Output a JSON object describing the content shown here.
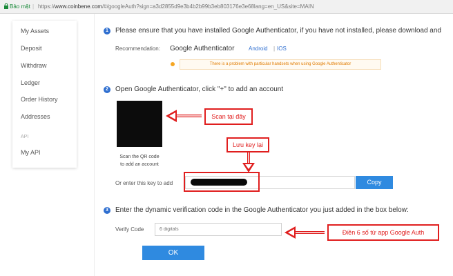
{
  "browser": {
    "secure_label": "Bảo mật",
    "separator": "|",
    "url_scheme": "https://",
    "url_host": "www.coinbene.com",
    "url_path": "/#/googleAuth?sign=a3d2855d9e3b4b2b99b3eb803176e3e68lang=en_US&site=MAIN"
  },
  "sidebar": {
    "items": [
      "My Assets",
      "Deposit",
      "Withdraw",
      "Ledger",
      "Order History",
      "Addresses"
    ],
    "section_label": "API",
    "api_item": "My API"
  },
  "step1": {
    "number": "1",
    "text": "Please ensure that you have installed Google Authenticator, if you have not installed, please download and",
    "recommendation_label": "Recommendation:",
    "app_name": "Google Authenticator",
    "android_link": "Android",
    "link_separator": "|",
    "ios_link": "IOS",
    "warning": "There is a problem with particular handsets when using Google Authenticator"
  },
  "step2": {
    "number": "2",
    "text": "Open Google Authenticator, click \"+\" to add an account",
    "qr_caption_line1": "Scan the QR code",
    "qr_caption_line2": "to add an account",
    "key_label": "Or enter this key to add",
    "copy_button": "Copy"
  },
  "step3": {
    "number": "3",
    "text": "Enter the dynamic verification code in the Google Authenticator you just added in the box below:",
    "verify_label": "Verify Code",
    "verify_placeholder": "6 digitals",
    "ok_button": "OK"
  },
  "annotations": {
    "scan_here": "Scan tại đây",
    "save_key": "Lưu key lại",
    "enter_code": "Điền 6 số từ app Google Auth"
  },
  "colors": {
    "accent": "#2f8ae0",
    "annotation": "#e01e1e",
    "warning": "#e07b00"
  }
}
